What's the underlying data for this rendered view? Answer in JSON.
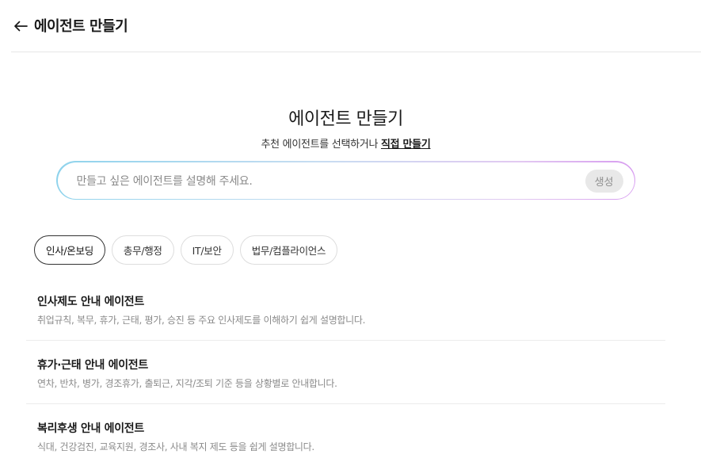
{
  "header": {
    "back_icon": "arrow-left-icon",
    "title": "에이전트 만들기"
  },
  "hero": {
    "title": "에이전트 만들기",
    "subtitle": "추천 에이전트를 선택하거나",
    "direct_link": "직접 만들기"
  },
  "search": {
    "placeholder": "만들고 싶은 에이전트를 설명해 주세요.",
    "value": "",
    "create_label": "생성"
  },
  "tabs": [
    {
      "label": "인사/온보딩",
      "active": true
    },
    {
      "label": "총무/행정",
      "active": false
    },
    {
      "label": "IT/보안",
      "active": false
    },
    {
      "label": "법무/컴플라이언스",
      "active": false
    }
  ],
  "agents": [
    {
      "title": "인사제도 안내 에이전트",
      "description": "취업규칙, 복무, 휴가, 근태, 평가, 승진 등 주요 인사제도를 이해하기 쉽게 설명합니다."
    },
    {
      "title": "휴가·근태 안내 에이전트",
      "description": "연차, 반차, 병가, 경조휴가, 출퇴근, 지각/조퇴 기준 등을 상황별로 안내합니다."
    },
    {
      "title": "복리후생 안내 에이전트",
      "description": "식대, 건강검진, 교육지원, 경조사, 사내 복지 제도 등을 쉽게 설명합니다."
    }
  ],
  "colors": {
    "gradient_start": "#8fd3ec",
    "gradient_end": "#d79cf0",
    "button_bg": "#e8e8e8",
    "divider": "#e6e6e6"
  }
}
